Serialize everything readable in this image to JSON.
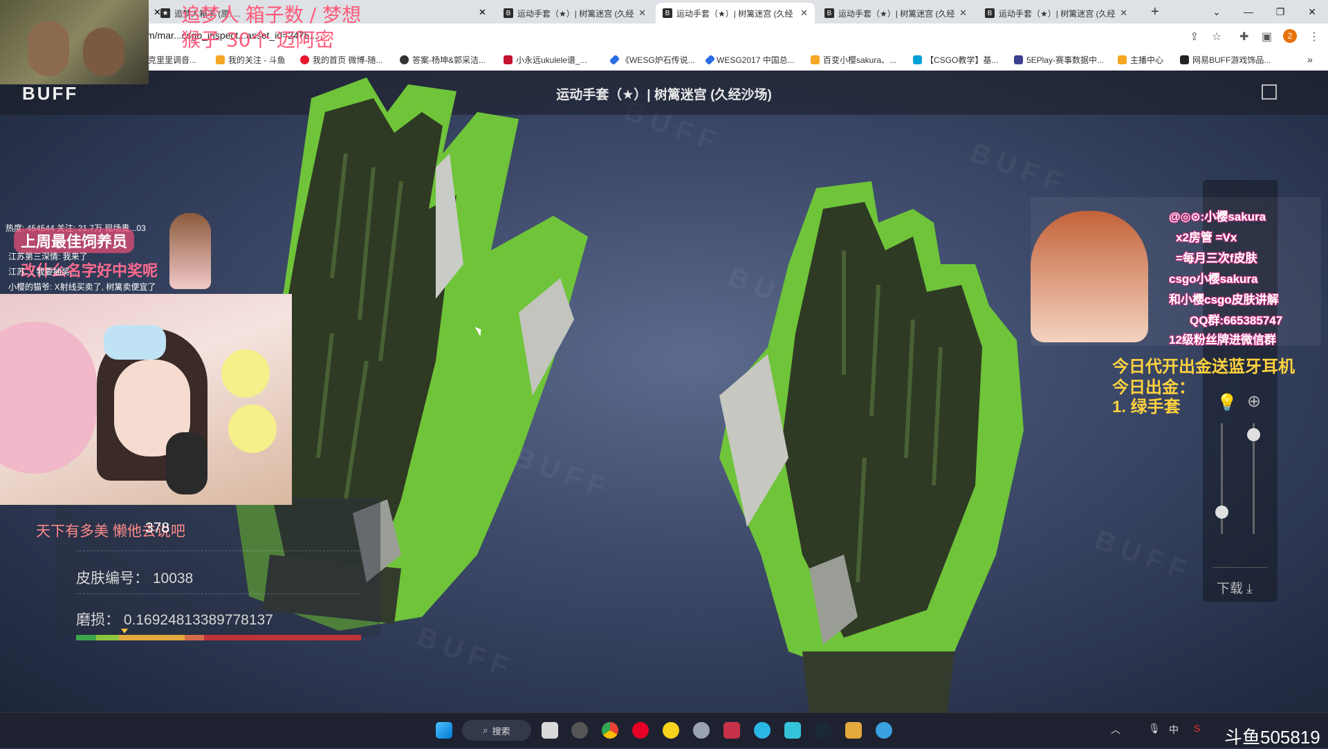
{
  "browser": {
    "tabs": [
      {
        "title": "追梦人箱子 (原: ...",
        "active": false
      },
      {
        "title": "运动手套（★）| 树篱迷宫 (久经",
        "active": false
      },
      {
        "title": "运动手套（★）| 树篱迷宫 (久经",
        "active": true
      },
      {
        "title": "运动手套（★）| 树篱迷宫 (久经",
        "active": false
      },
      {
        "title": "运动手套（★）| 树篱迷宫 (久经",
        "active": false
      }
    ],
    "new_tab": "+",
    "url": "m/mar...csgo_inspect...asset_id=2475...",
    "profile_badge": "2",
    "bookmarks": [
      "克里里调音...",
      "我的关注 - 斗鱼",
      "我的首页 微博-随...",
      "答案-杨坤&郭采洁...",
      "小永远ukulele谱_...",
      "《WESG炉石传说...",
      "WESG2017 中国总...",
      "百变小樱sakura、...",
      "【CSGO教学】基...",
      "5EPlay-赛事数据中...",
      "主播中心",
      "网易BUFF游戏饰品..."
    ]
  },
  "page": {
    "logo": "BUFF",
    "item_title": "运动手套（★）| 树篱迷宫 (久经沙场)",
    "watermark": "BUFF",
    "info": {
      "pattern_label": "图案模板 (paint seed)：",
      "pattern_value": "378",
      "skin_id_label": "皮肤编号：",
      "skin_id_value": "10038",
      "wear_label": "磨损：",
      "wear_value": "0.16924813389778137",
      "wear_fraction": 0.169
    },
    "download_label": "下载 ⤓",
    "light_slider_fraction": 0.2,
    "zoom_slider_fraction": 0.9
  },
  "overlays": {
    "top_text_1": "追梦人 箱子数 / 梦想",
    "top_text_2": "猴子 30个 迈阿密",
    "stats": "热度: 454544  关注: 21.7万  现场贵...03",
    "banner_1": "上周最佳饲养员",
    "banner_2": "改什么名字好中奖呢",
    "chat_1": "江苏第三深情: 我来了",
    "chat_2": "江苏...: 我要抽奖...",
    "chat_3": "小樱的猫爷: X射线买卖了, 树篱卖便宜了",
    "danmu": "天下有多美 懒他去说吧",
    "announcement_1": "今日代开出金送蓝牙耳机",
    "announcement_2": "今日出金：",
    "announcement_3": "1. 绿手套",
    "sakura_lines": [
      "@◎⊙:小樱sakura",
      "x2房管 =Vx",
      "=每月三次f皮肤",
      "csgo小樱sakura",
      "和小樱csgo皮肤讲解",
      "QQ群:665385747",
      "12级粉丝牌进微信群"
    ],
    "douyu_id": "斗鱼505819"
  },
  "taskbar": {
    "search_label": "搜索",
    "ime": "中"
  }
}
